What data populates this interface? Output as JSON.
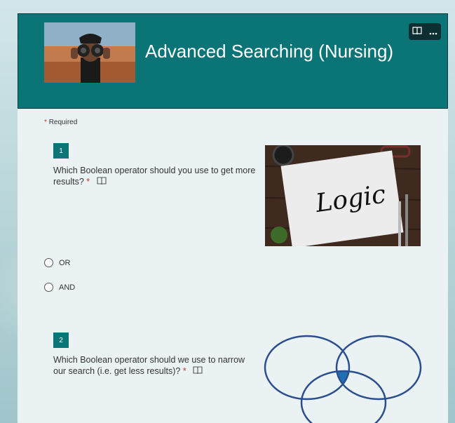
{
  "header": {
    "title": "Advanced Searching (Nursing)",
    "colors": {
      "banner": "#0a7477",
      "accent": "#0a7477"
    }
  },
  "required_note": {
    "star": "*",
    "label": "Required"
  },
  "questions": [
    {
      "number": "1",
      "text_line1": "Which Boolean operator should you use to get more",
      "text_line2": "results?",
      "star": "*",
      "image_text": "Logic",
      "choices": [
        "OR",
        "AND"
      ]
    },
    {
      "number": "2",
      "text_line1": "Which Boolean operator should we use to narrow",
      "text_line2": "our search (i.e. get less results)?",
      "star": "*"
    }
  ],
  "icons": [
    "immersive-reader-icon",
    "more-options-icon"
  ]
}
